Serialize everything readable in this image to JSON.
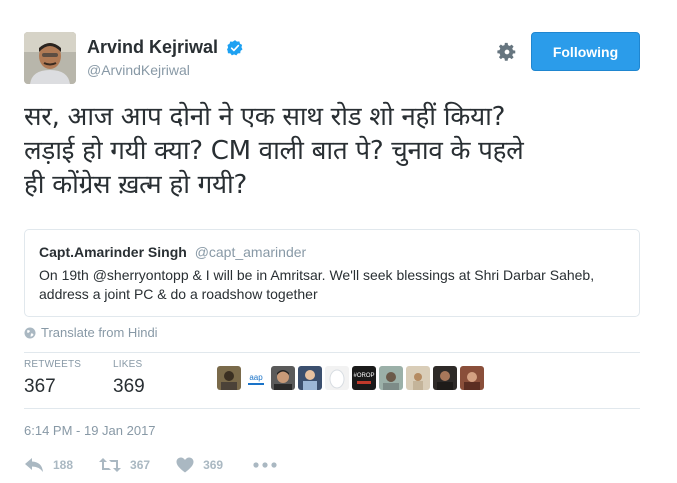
{
  "author": {
    "name": "Arvind Kejriwal",
    "handle": "@ArvindKejriwal",
    "verified_icon": "verified-badge-icon"
  },
  "follow_button": {
    "label": "Following",
    "color": "#2b9cea"
  },
  "tweet": {
    "text_line1": "सर, आज आप दोनो ने एक साथ रोड शो नहीं किया?",
    "text_line2": "लड़ाई हो गयी क्या? CM वाली बात पे? चुनाव के पहले",
    "text_line3": "ही कोंग्रेस ख़त्म हो गयी?"
  },
  "quoted_tweet": {
    "name": "Capt.Amarinder Singh",
    "handle": "@capt_amarinder",
    "text_line1": "On 19th @sherryontopp  & I will be in Amritsar. We'll seek blessings at Shri Darbar Saheb,",
    "text_line2": "address a joint PC & do a roadshow together"
  },
  "translate": {
    "label": "Translate from Hindi"
  },
  "stats": {
    "retweets_label": "RETWEETS",
    "retweets_value": "367",
    "likes_label": "LIKES",
    "likes_value": "369"
  },
  "liker_avatars": [
    {
      "badge": ""
    },
    {
      "badge": "aap"
    },
    {
      "badge": ""
    },
    {
      "badge": ""
    },
    {
      "badge": "#OROP"
    },
    {
      "badge": ""
    },
    {
      "badge": ""
    },
    {
      "badge": ""
    },
    {
      "badge": ""
    }
  ],
  "timestamp": "6:14 PM - 19 Jan 2017",
  "actions": {
    "reply_count": "188",
    "retweet_count": "367",
    "like_count": "369"
  },
  "colors": {
    "text": "#292f33",
    "muted": "#8899a6",
    "border": "#e1e8ed",
    "icon_gray": "#aab8c2",
    "verified": "#1da1f2"
  }
}
